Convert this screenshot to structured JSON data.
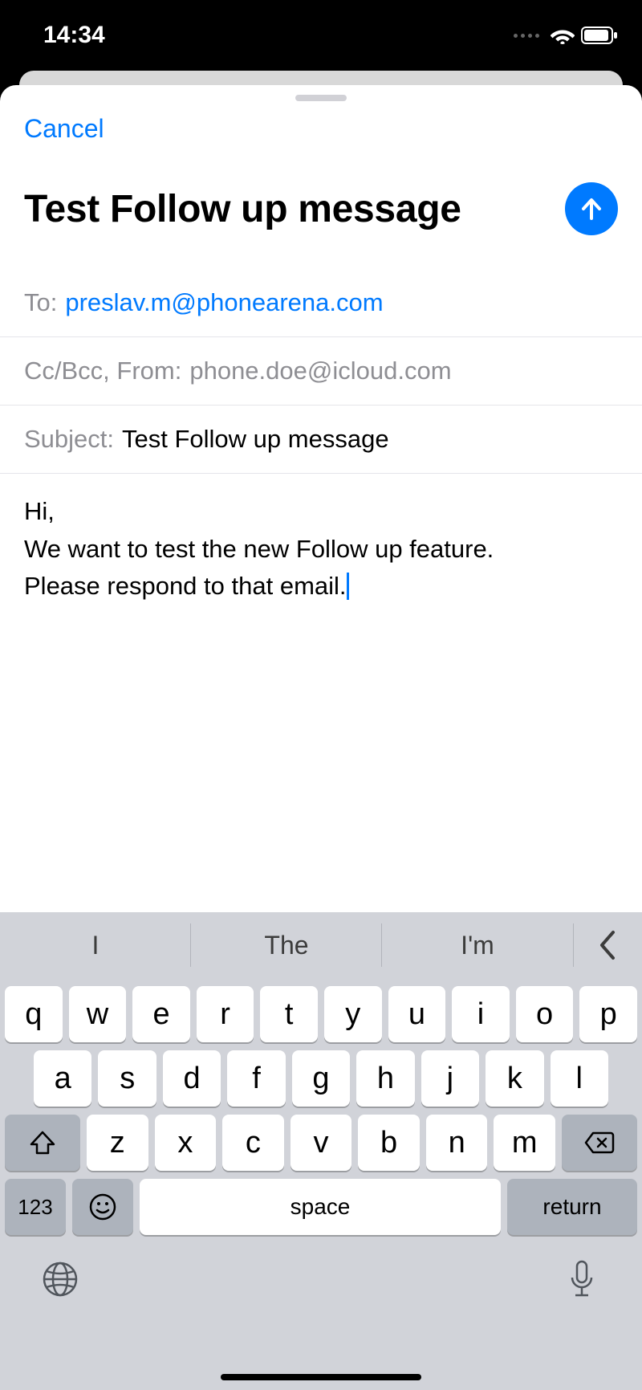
{
  "statusbar": {
    "time": "14:34"
  },
  "nav": {
    "cancel": "Cancel"
  },
  "compose": {
    "title": "Test Follow up message"
  },
  "fields": {
    "to_label": "To:",
    "to_value": "preslav.m@phonearena.com",
    "ccbcc_label": "Cc/Bcc, From:",
    "from_value": "phone.doe@icloud.com",
    "subject_label": "Subject:",
    "subject_value": "Test Follow up message"
  },
  "body": {
    "line1": "Hi,",
    "line2": "We want to test the new Follow up feature.",
    "line3": "Please respond to that email."
  },
  "suggestions": {
    "s1": "I",
    "s2": "The",
    "s3": "I'm"
  },
  "keyboard": {
    "row1": [
      "q",
      "w",
      "e",
      "r",
      "t",
      "y",
      "u",
      "i",
      "o",
      "p"
    ],
    "row2": [
      "a",
      "s",
      "d",
      "f",
      "g",
      "h",
      "j",
      "k",
      "l"
    ],
    "row3": [
      "z",
      "x",
      "c",
      "v",
      "b",
      "n",
      "m"
    ],
    "numkey": "123",
    "space": "space",
    "return": "return"
  }
}
